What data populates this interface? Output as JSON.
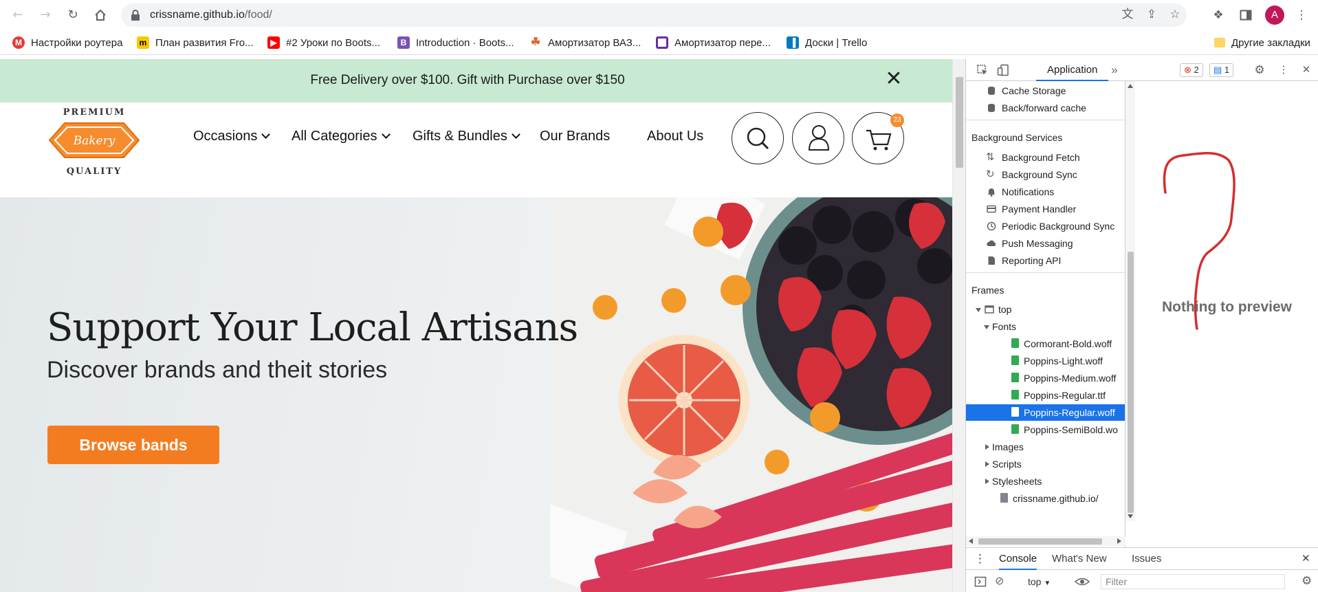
{
  "browser": {
    "url_host": "crissname.github.io",
    "url_path": "/food/",
    "avatar_letter": "A",
    "bookmarks": [
      {
        "label": "Настройки роутера",
        "color": "#e53935"
      },
      {
        "label": "План развития Fro...",
        "color": "#f9c800"
      },
      {
        "label": "#2 Уроки по Boots...",
        "color": "#ff0000"
      },
      {
        "label": "Introduction · Boots...",
        "color": "#7952b3"
      },
      {
        "label": "Амортизатор ВАЗ...",
        "color": "#e2602b"
      },
      {
        "label": "Амортизатор пере...",
        "color": "#6a2d9f"
      },
      {
        "label": "Доски | Trello",
        "color": "#0079bf"
      }
    ],
    "other_bookmarks": "Другие закладки"
  },
  "site": {
    "promo": "Free Delivery over $100. Gift with Purchase over $150",
    "logo": {
      "top": "PREMIUM",
      "middle": "Bakery",
      "bottom": "QUALITY"
    },
    "menu": [
      "Occasions",
      "All Categories",
      "Gifts & Bundles",
      "Our Brands",
      "About Us"
    ],
    "cart_count": "23",
    "hero_title": "Support Your Local Artisans",
    "hero_subtitle": "Discover brands and theit stories",
    "hero_button": "Browse bands",
    "accent": "#f47c20"
  },
  "devtools": {
    "active_tab": "Application",
    "errors": "2",
    "messages": "1",
    "storage_items": [
      "Cache Storage",
      "Back/forward cache"
    ],
    "bg_services_title": "Background Services",
    "bg_services": [
      "Background Fetch",
      "Background Sync",
      "Notifications",
      "Payment Handler",
      "Periodic Background Sync",
      "Push Messaging",
      "Reporting API"
    ],
    "frames_title": "Frames",
    "frame_top": "top",
    "fonts_folder": "Fonts",
    "fonts": [
      "Cormorant-Bold.woff",
      "Poppins-Light.woff",
      "Poppins-Medium.woff",
      "Poppins-Regular.ttf",
      "Poppins-Regular.woff",
      "Poppins-SemiBold.wo"
    ],
    "folders": [
      "Images",
      "Scripts",
      "Stylesheets"
    ],
    "doc": "crissname.github.io/",
    "preview_text": "Nothing to preview",
    "drawer_tabs": [
      "Console",
      "What's New",
      "Issues"
    ],
    "context": "top",
    "filter_placeholder": "Filter"
  }
}
